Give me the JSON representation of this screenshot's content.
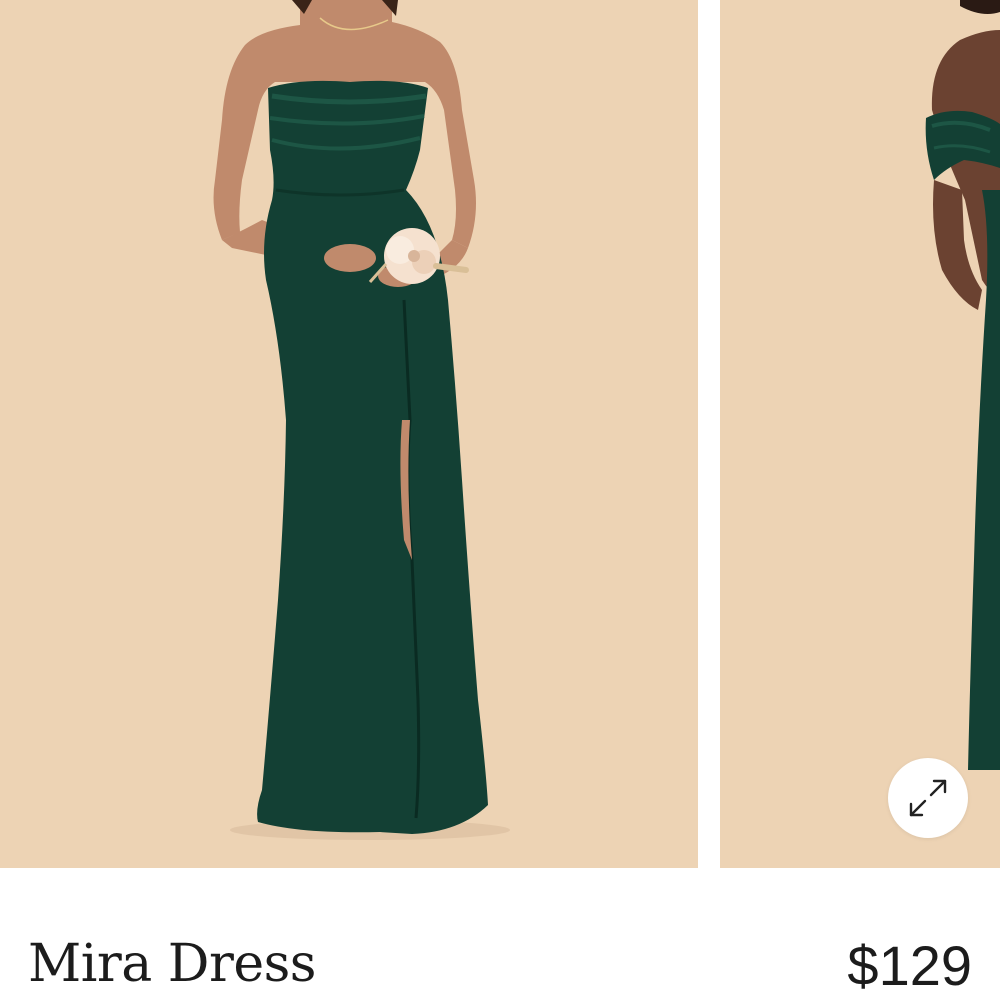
{
  "colors": {
    "backdrop": "#edd3b4",
    "dress": "#134034",
    "dress_highlight": "#1d5645",
    "skin": "#c08a6c",
    "skin_dark": "#6b4231",
    "bouquet": "#f5e1cf",
    "text": "#1c1c1c"
  },
  "gallery": {
    "image_1": {
      "alt": "mira-dress-front-view"
    },
    "image_2": {
      "alt": "off-shoulder-dress-partial-view"
    },
    "expand_icon": "expand-arrows-icon"
  },
  "product": {
    "name": "Mira Dress",
    "price": "$129"
  }
}
